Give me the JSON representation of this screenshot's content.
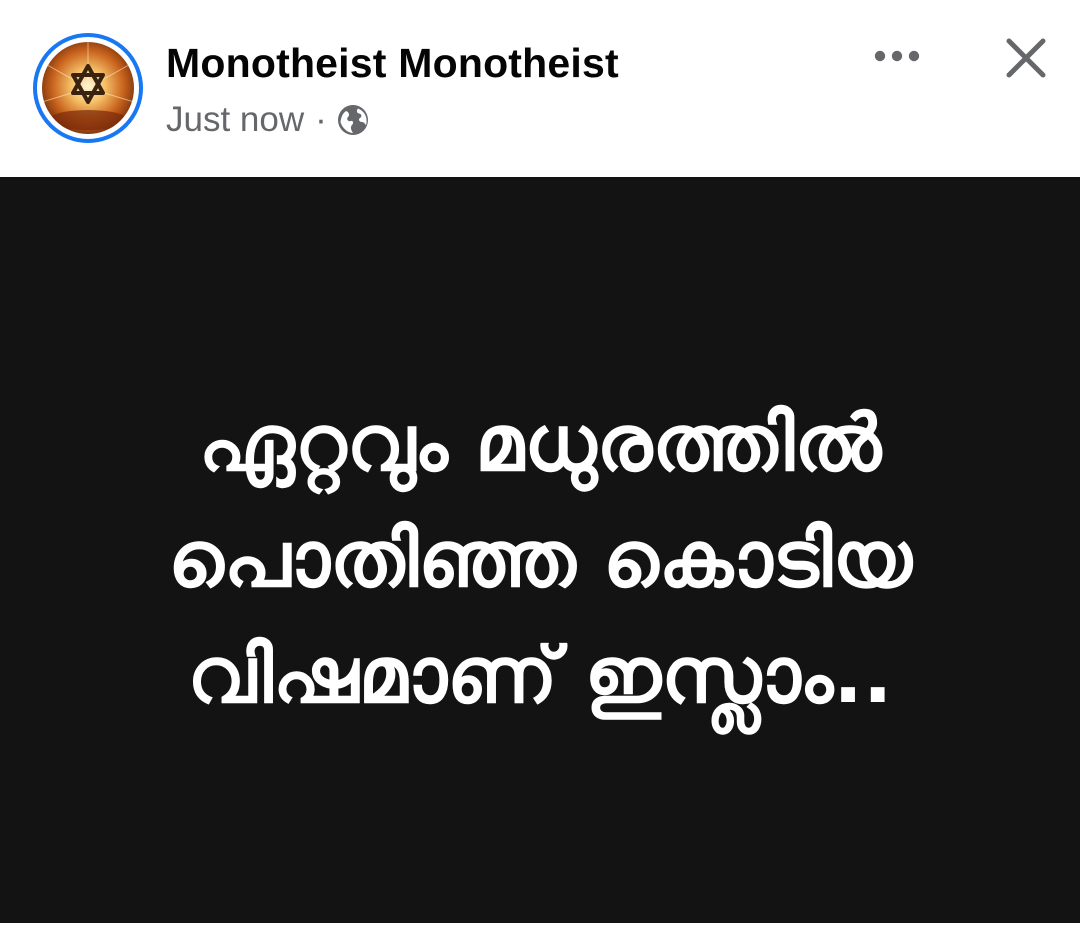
{
  "post": {
    "author": "Monotheist Monotheist",
    "timestamp": "Just now",
    "separator": "·",
    "privacy_icon": "globe-icon",
    "avatar_icon": "star-of-david-icon",
    "more_icon": "more-options-icon",
    "close_icon": "close-icon",
    "image_text_lines": [
      "ഏറ്റവും മധുരത്തിൽ",
      "പൊതിഞ്ഞ കൊടിയ",
      "വിഷമാണ് ഇസ്ലാം.."
    ]
  },
  "colors": {
    "accent": "#1877f2",
    "name_text": "#050505",
    "meta_text": "#65676b",
    "image_background": "#131313",
    "image_text": "#ffffff"
  }
}
